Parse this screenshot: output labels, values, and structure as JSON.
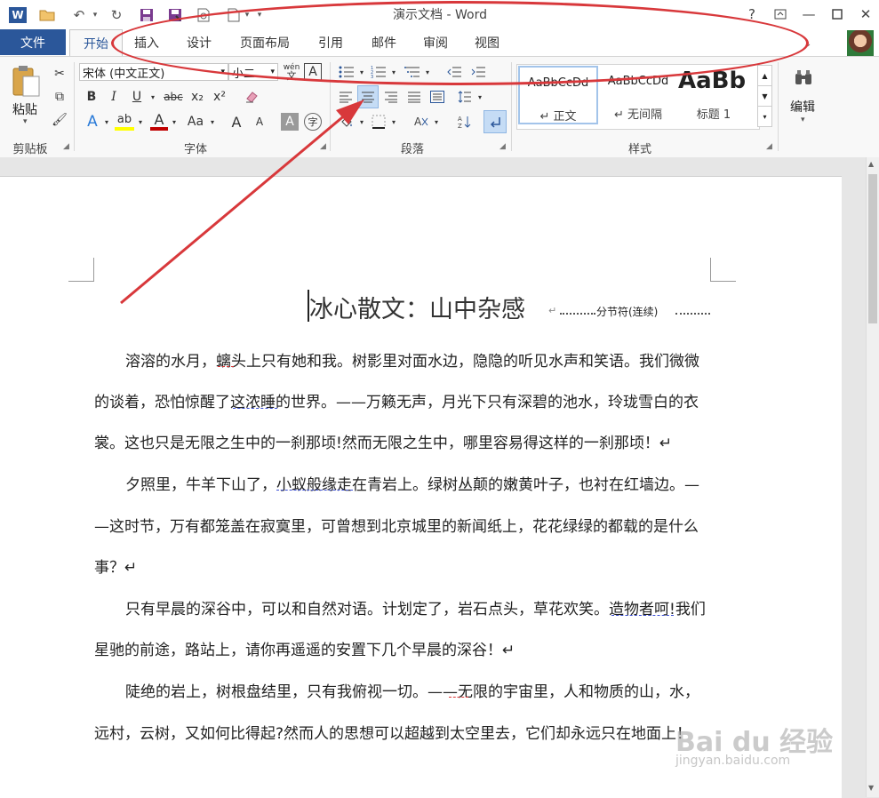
{
  "titlebar": {
    "title": "演示文档 - Word",
    "word_icon": "W",
    "help": "?"
  },
  "tabs": [
    "文件",
    "开始",
    "插入",
    "设计",
    "页面布局",
    "引用",
    "邮件",
    "审阅",
    "视图"
  ],
  "ribbon": {
    "clipboard": {
      "paste_label": "粘贴",
      "group_label": "剪贴板"
    },
    "font": {
      "font_name": "宋体 (中文正文)",
      "font_size": "小二",
      "phonetic": "wén",
      "group_label": "字体",
      "bold": "B",
      "italic": "I",
      "underline": "U",
      "strike": "abc",
      "subscript": "x₂",
      "superscript": "x²",
      "case": "Aa",
      "grow": "A",
      "shrink": "A",
      "highlight_color": "#ffff00",
      "font_color": "#c00000"
    },
    "paragraph": {
      "group_label": "段落"
    },
    "styles": {
      "group_label": "样式",
      "items": [
        {
          "sample": "AaBbCcDd",
          "name": "↵ 正文"
        },
        {
          "sample": "AaBbCcDd",
          "name": "↵ 无间隔"
        },
        {
          "sample": "AaBb",
          "name": "标题 1"
        }
      ]
    },
    "editing": {
      "label": "编辑"
    }
  },
  "document": {
    "title": "冰心散文：山中杂感",
    "title_mark": "↵",
    "section_break": "分节符(连续)",
    "lines": [
      "溶溶的水月，螭头上只有她和我。树影里对面水边，隐隐的听见水声和笑语。我们微微",
      "的谈着，恐怕惊醒了这浓睡的世界。——万籁无声，月光下只有深碧的池水，玲珑雪白的衣",
      "裳。这也只是无限之生中的一刹那顷!然而无限之生中，哪里容易得这样的一刹那顷！↵",
      "夕照里，牛羊下山了，小蚁般缘走在青岩上。绿树丛颠的嫩黄叶子，也衬在红墙边。—",
      "—这时节，万有都笼盖在寂寞里，可曾想到北京城里的新闻纸上，花花绿绿的都载的是什么",
      "事？↵",
      "只有早晨的深谷中，可以和自然对语。计划定了，岩石点头，草花欢笑。造物者呵!我们",
      "星驰的前途，路站上，请你再遥遥的安置下几个早晨的深谷！↵",
      "陡绝的岩上，树根盘结里，只有我俯视一切。——无限的宇宙里，人和物质的山，水，",
      "远村，云树，又如何比得起?然而人的思想可以超越到太空里去，它们却永远只在地面上！"
    ]
  },
  "watermark": {
    "brand": "Bai du 经验",
    "url": "jingyan.baidu.com"
  },
  "colors": {
    "accent": "#2b579a",
    "annotation": "#d8383b"
  }
}
